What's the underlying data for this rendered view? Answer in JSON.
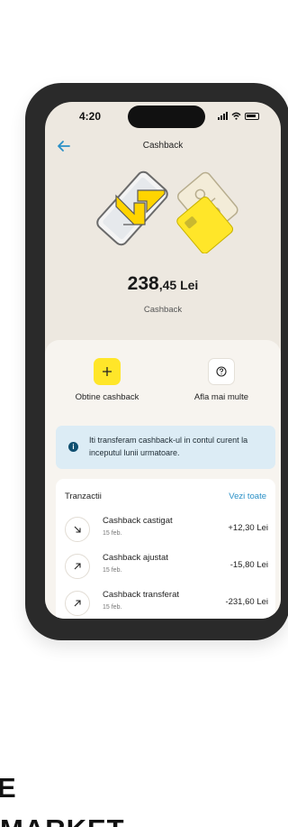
{
  "status_bar": {
    "time": "4:20"
  },
  "header": {
    "title": "Cashback"
  },
  "balance": {
    "integer": "238",
    "decimals": ",45",
    "currency": " Lei",
    "label": "Cashback"
  },
  "actions": [
    {
      "label": "Obtine cashback",
      "icon": "plus-icon"
    },
    {
      "label": "Afla mai multe",
      "icon": "help-icon"
    }
  ],
  "info": {
    "text": "Iti transferam cashback-ul in contul curent la inceputul lunii urmatoare."
  },
  "transactions": {
    "title": "Tranzactii",
    "see_all": "Vezi toate",
    "items": [
      {
        "name": "Cashback castigat",
        "date": "15 feb.",
        "amount": "+12,30 Lei",
        "icon": "arrow-down-right-icon"
      },
      {
        "name": "Cashback ajustat",
        "date": "15 feb.",
        "amount": "-15,80 Lei",
        "icon": "arrow-up-right-icon"
      },
      {
        "name": "Cashback transferat",
        "date": "15 feb.",
        "amount": "-231,60 Lei",
        "icon": "arrow-up-right-icon"
      }
    ]
  },
  "marketing": {
    "line1": "E",
    "line2": "MARKET"
  },
  "colors": {
    "accent_yellow": "#ffe629",
    "link_blue": "#2a90c7",
    "screen_bg": "#ede8e0",
    "info_bg": "#dcecf5"
  }
}
